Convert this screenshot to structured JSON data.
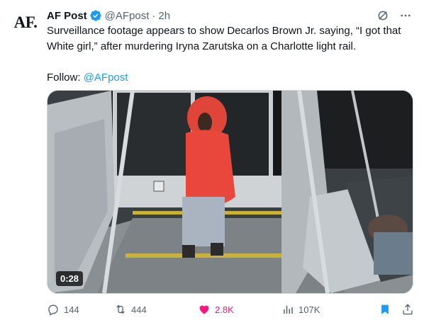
{
  "tweet": {
    "avatar_text": "AF.",
    "display_name": "AF Post",
    "handle": "@AFpost",
    "separator": "·",
    "time": "2h",
    "text_line1": "Surveillance footage appears to show Decarlos Brown Jr. saying, “I got that White girl,” after murdering Iryna Zarutska on a Charlotte light rail.",
    "follow_label": "Follow:",
    "follow_handle": "@AFpost"
  },
  "media": {
    "duration": "0:28"
  },
  "actions": {
    "replies": "144",
    "reposts": "444",
    "likes": "2.8K",
    "views": "107K"
  },
  "colors": {
    "accent": "#1d9bf0",
    "like": "#f91880",
    "bookmark": "#1d9bf0",
    "muted": "#536471"
  }
}
